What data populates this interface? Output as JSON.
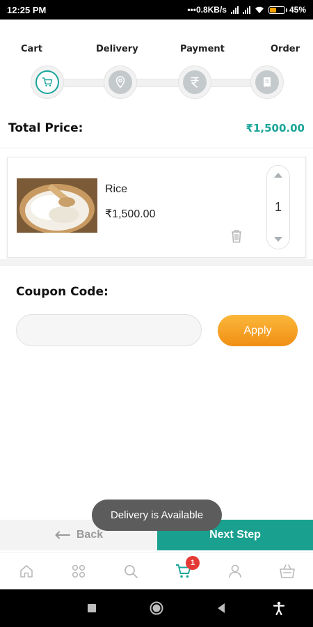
{
  "status_bar": {
    "time": "12:25 PM",
    "network_speed": "0.8KB/s",
    "battery": "45%",
    "battery_level": 0.45
  },
  "steps": [
    {
      "label": "Cart",
      "icon": "cart-icon",
      "active": true
    },
    {
      "label": "Delivery",
      "icon": "location-pin-icon",
      "active": false
    },
    {
      "label": "Payment",
      "icon": "rupee-icon",
      "active": false
    },
    {
      "label": "Order",
      "icon": "receipt-icon",
      "active": false
    }
  ],
  "total": {
    "label": "Total Price:",
    "value": "₹1,500.00"
  },
  "cart_item": {
    "name": "Rice",
    "price": "₹1,500.00",
    "quantity": "1"
  },
  "coupon": {
    "title": "Coupon Code:",
    "placeholder": "",
    "value": "",
    "apply_label": "Apply"
  },
  "actions": {
    "back_label": "Back",
    "next_label": "Next Step"
  },
  "toast": {
    "message": "Delivery is Available"
  },
  "tabbar": {
    "items": [
      "home-icon",
      "grid-icon",
      "search-icon",
      "cart-icon",
      "user-icon",
      "basket-icon"
    ],
    "cart_badge": "1"
  },
  "colors": {
    "accent": "#1aa59a",
    "apply": "#f5a623",
    "badge": "#e53935"
  }
}
